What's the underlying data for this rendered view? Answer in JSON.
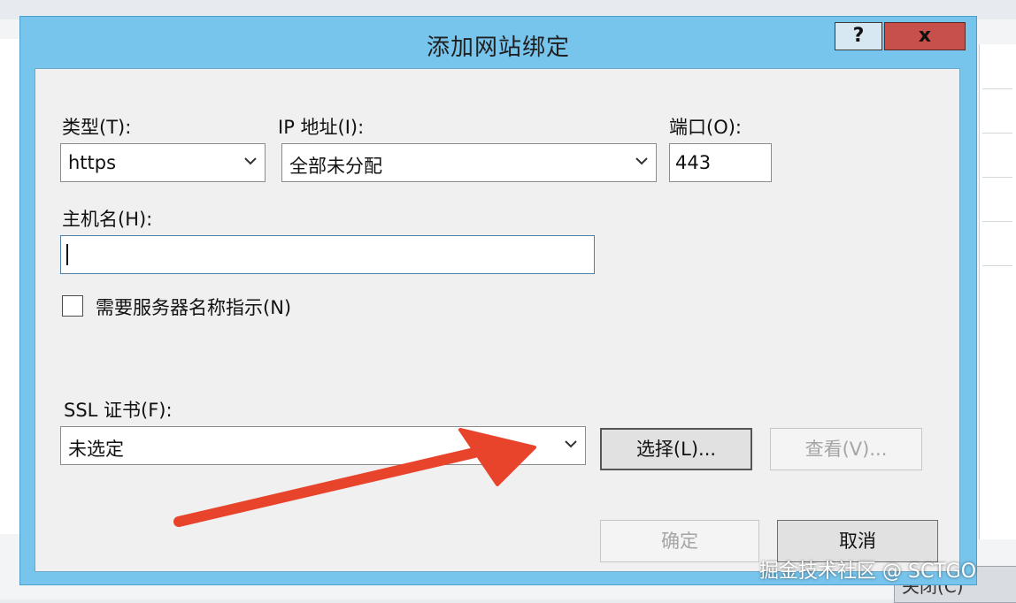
{
  "dialog": {
    "title": "添加网站绑定",
    "help_label": "?",
    "close_label": "x"
  },
  "fields": {
    "type_label": "类型(T):",
    "type_value": "https",
    "ip_label": "IP 地址(I):",
    "ip_value": "全部未分配",
    "port_label": "端口(O):",
    "port_value": "443",
    "host_label": "主机名(H):",
    "host_value": "",
    "sni_label": "需要服务器名称指示(N)",
    "ssl_label": "SSL 证书(F):",
    "ssl_value": "未选定"
  },
  "buttons": {
    "select_label": "选择(L)...",
    "view_label": "查看(V)...",
    "ok_label": "确定",
    "cancel_label": "取消"
  },
  "background": {
    "partial_button_label": "关闭(C)"
  },
  "watermark": "掘金技术社区 @ SCTGO",
  "colors": {
    "dialog_frame": "#77c4ec",
    "close_button": "#c7504a",
    "annotation_arrow": "#e8432b"
  }
}
